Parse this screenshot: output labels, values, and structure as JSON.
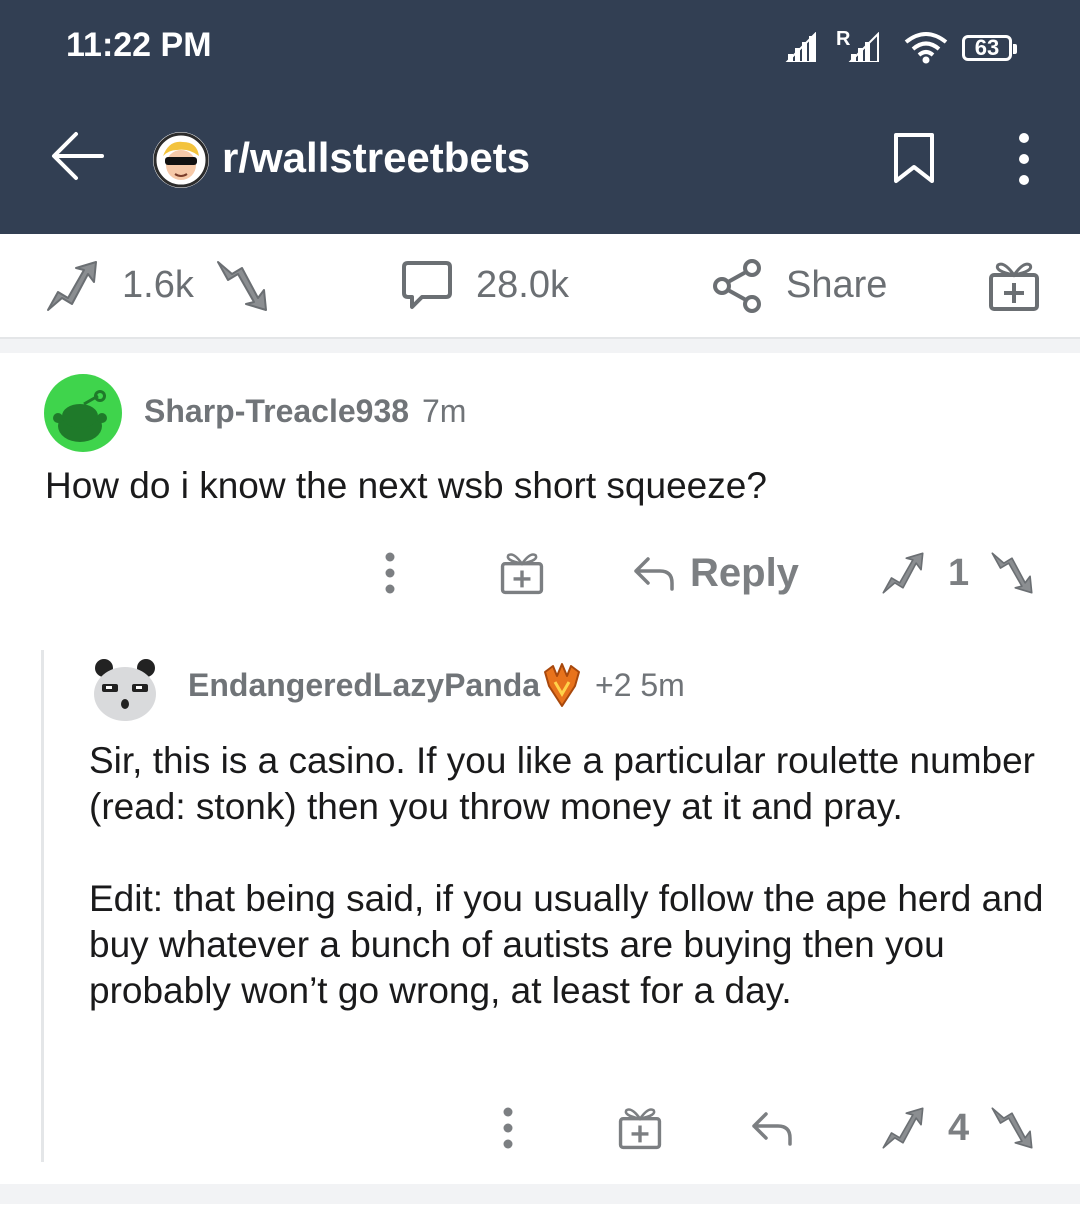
{
  "status_bar": {
    "time": "11:22 PM",
    "roaming_label": "R",
    "battery": "63",
    "icons": [
      "signal-icon",
      "roaming-signal-icon",
      "wifi-icon",
      "battery-icon"
    ]
  },
  "header": {
    "subreddit": "r/wallstreetbets",
    "icons": [
      "back-arrow-icon",
      "subreddit-avatar",
      "bookmark-icon",
      "overflow-menu-icon"
    ]
  },
  "post_actions": {
    "score": "1.6k",
    "comments": "28.0k",
    "share_label": "Share",
    "icons": [
      "upvote-icon",
      "downvote-icon",
      "comment-icon",
      "share-icon",
      "award-icon"
    ]
  },
  "comments": [
    {
      "author": "Sharp-Treacle938",
      "time": "7m",
      "body": "How do i know the next wsb short squeeze?",
      "reply_label": "Reply",
      "score": "1"
    },
    {
      "author": "EndangeredLazyPanda",
      "awards": "+2",
      "time": "5m",
      "paragraphs": [
        "Sir, this is a casino. If you like a particular roulette number (read: stonk) then you throw money at it and pray.",
        "Edit: that being said, if you usually follow the ape herd and buy whatever a bunch of autists are buying then you probably won’t go wrong, at least for a day."
      ],
      "score": "4"
    }
  ],
  "colors": {
    "header_bg": "#323f53",
    "action_gray": "#7c7f82",
    "avatar_green": "#3fd44c"
  }
}
